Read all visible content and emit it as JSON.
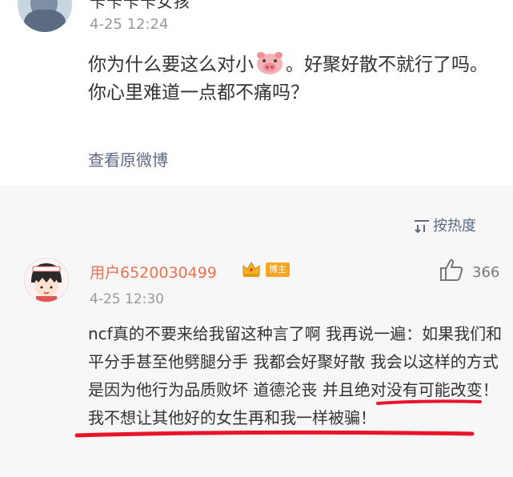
{
  "post": {
    "author": "卡卡卡卡女孩",
    "time": "4-25 12:24",
    "text_before_icon": "你为什么要这么对小",
    "pig_icon": "pig-emoji",
    "text_after_icon": "。好聚好散不就行了吗。你心里难道一点都不痛吗？",
    "view_original": "查看原微博"
  },
  "sort": {
    "label": "按热度",
    "icon": "sort-icon"
  },
  "comment": {
    "username": "用户6520030499",
    "crown_icon": "crown-icon",
    "badge": "博主",
    "like_icon": "thumbs-up-icon",
    "likes": "366",
    "time": "4-25 12:30",
    "text": "ncf真的不要来给我留这种言了啊 我再说一遍：如果我们和平分手甚至他劈腿分手 我都会好聚好散 我会以这样的方式是因为他行为品质败坏 道德沦丧 并且绝对没有可能改变！我不想让其他好的女生再和我一样被骗！"
  },
  "colors": {
    "username": "#eb7350",
    "link": "#5b6b85",
    "gray_text": "#999999",
    "badge": "#f6a623",
    "underline": "#e8142a",
    "gray_bg": "#f7f7f7"
  }
}
